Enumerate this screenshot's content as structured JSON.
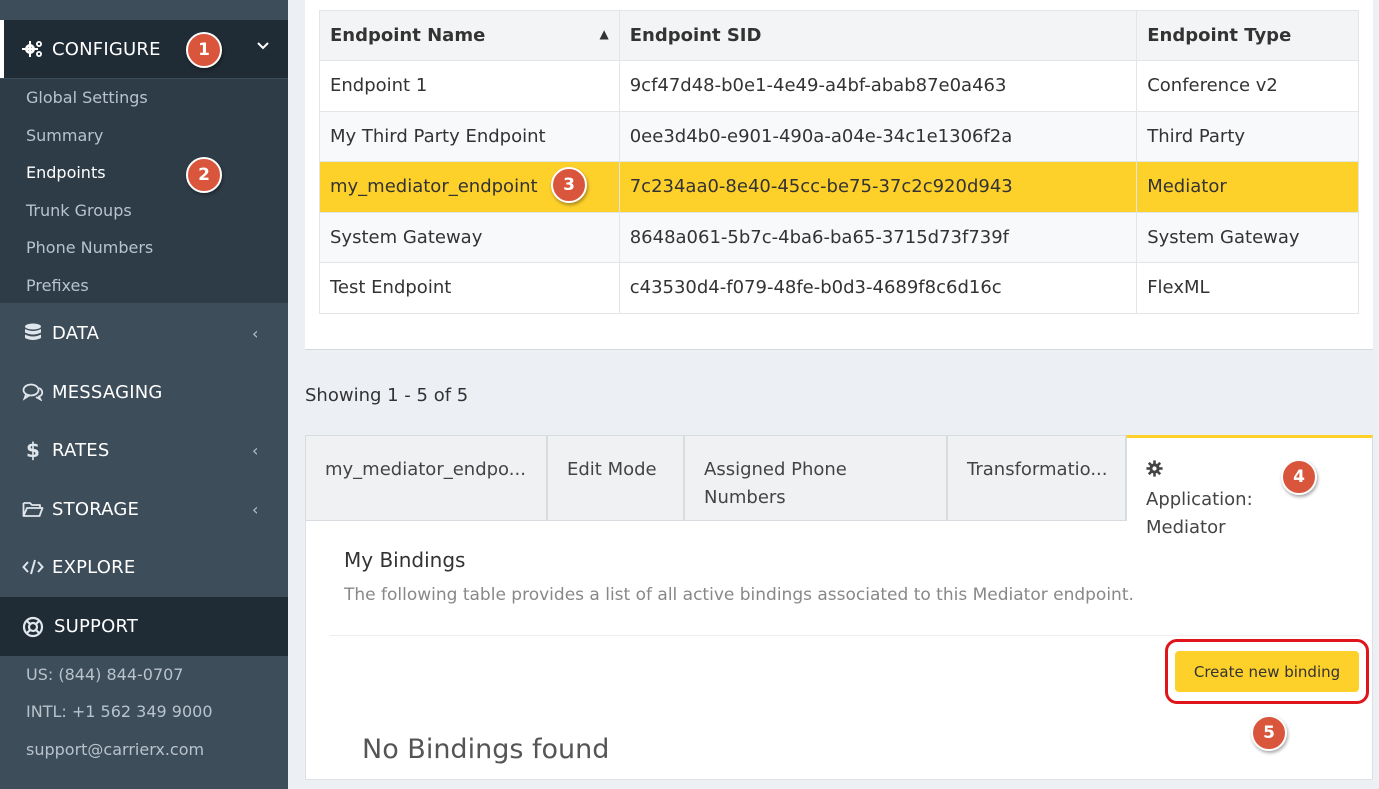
{
  "sidebar": {
    "configure": {
      "label": "CONFIGURE",
      "icon": "gears-icon"
    },
    "sub_items": [
      {
        "label": "Global Settings"
      },
      {
        "label": "Summary"
      },
      {
        "label": "Endpoints"
      },
      {
        "label": "Trunk Groups"
      },
      {
        "label": "Phone Numbers"
      },
      {
        "label": "Prefixes"
      }
    ],
    "items": [
      {
        "label": "DATA",
        "icon": "database-icon",
        "chevron": "‹"
      },
      {
        "label": "MESSAGING",
        "icon": "chat-icon",
        "chevron": ""
      },
      {
        "label": "RATES",
        "icon": "dollar-icon",
        "chevron": "‹"
      },
      {
        "label": "STORAGE",
        "icon": "folder-icon",
        "chevron": "‹"
      },
      {
        "label": "EXPLORE",
        "icon": "code-icon",
        "chevron": ""
      }
    ],
    "support": {
      "label": "SUPPORT",
      "icon": "lifebuoy-icon"
    },
    "support_info": [
      "US: (844) 844-0707",
      "INTL: +1 562 349 9000",
      "support@carrierx.com"
    ]
  },
  "table": {
    "headers": [
      "Endpoint Name",
      "Endpoint SID",
      "Endpoint Type"
    ],
    "sort_indicator": "▲",
    "rows": [
      [
        "Endpoint 1",
        "9cf47d48-b0e1-4e49-a4bf-abab87e0a463",
        "Conference v2"
      ],
      [
        "My Third Party Endpoint",
        "0ee3d4b0-e901-490a-a04e-34c1e1306f2a",
        "Third Party"
      ],
      [
        "my_mediator_endpoint",
        "7c234aa0-8e40-45cc-be75-37c2c920d943",
        "Mediator"
      ],
      [
        "System Gateway",
        "8648a061-5b7c-4ba6-ba65-3715d73f739f",
        "System Gateway"
      ],
      [
        "Test Endpoint",
        "c43530d4-f079-48fe-b0d3-4689f8c6d16c",
        "FlexML"
      ]
    ],
    "selected_row": 2
  },
  "showing": "Showing 1 - 5 of 5",
  "tabs": [
    {
      "label": "my_mediator_endpo..."
    },
    {
      "label": "Edit Mode"
    },
    {
      "label": "Assigned Phone Numbers"
    },
    {
      "label": "Transformatio..."
    },
    {
      "label": "Application: Mediator",
      "icon": "gear-icon"
    }
  ],
  "bindings": {
    "title": "My Bindings",
    "description": "The following table provides a list of all active bindings associated to this Mediator endpoint.",
    "create_button": "Create new binding",
    "empty": "No Bindings found"
  },
  "markers": [
    "1",
    "2",
    "3",
    "4",
    "5"
  ],
  "colors": {
    "accent": "#fdd02a",
    "marker": "#d9553b",
    "highlight_ring": "#e0151b",
    "sidebar": "#3e4d5a"
  }
}
